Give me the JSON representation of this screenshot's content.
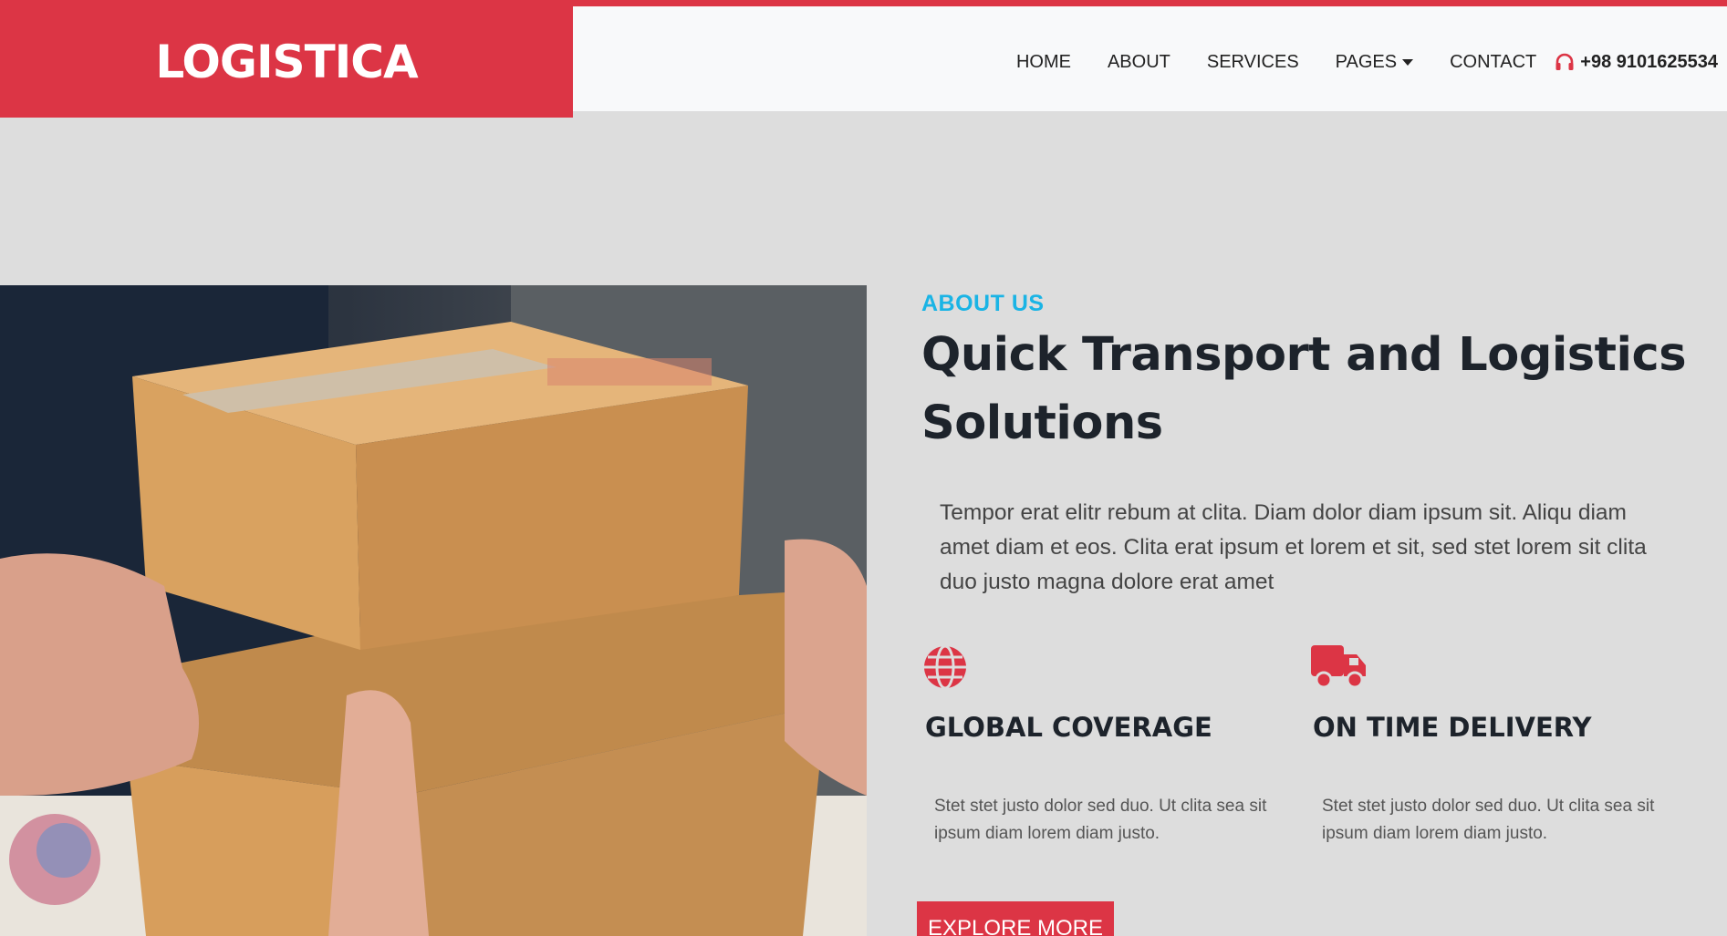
{
  "brand": {
    "name": "LOGISTICA"
  },
  "nav": {
    "items": [
      {
        "label": "HOME"
      },
      {
        "label": "ABOUT"
      },
      {
        "label": "SERVICES"
      },
      {
        "label": "PAGES"
      },
      {
        "label": "CONTACT"
      }
    ],
    "phone": "+98 9101625534"
  },
  "about": {
    "eyebrow": "ABOUT US",
    "headline": "Quick Transport and Logistics Solutions",
    "lead": "Tempor erat elitr rebum at clita. Diam dolor diam ipsum sit. Aliqu diam amet diam et eos. Clita erat ipsum et lorem et sit, sed stet lorem sit clita duo justo magna dolore erat amet",
    "features": [
      {
        "icon": "globe-icon",
        "title": "GLOBAL COVERAGE",
        "text": "Stet stet justo dolor sed duo. Ut clita sea sit ipsum diam lorem diam justo."
      },
      {
        "icon": "truck-icon",
        "title": "ON TIME DELIVERY",
        "text": "Stet stet justo dolor sed duo. Ut clita sea sit ipsum diam lorem diam justo."
      }
    ],
    "cta": "EXPLORE MORE"
  },
  "colors": {
    "primary": "#dc3545",
    "accent": "#1ab4e5",
    "background": "#dddddd"
  }
}
